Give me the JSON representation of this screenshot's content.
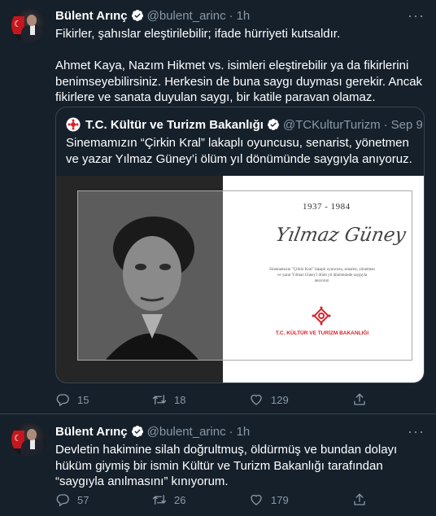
{
  "tweets": [
    {
      "author": {
        "name": "Bülent Arınç",
        "handle": "@bulent_arinc"
      },
      "time": "1h",
      "paragraphs": [
        "Fikirler, şahıslar eleştirilebilir; ifade hürriyeti kutsaldır.",
        "Ahmet Kaya, Nazım Hikmet vs. isimleri eleştirebilir ya da fikirlerini benimseyebilirsiniz. Herkesin de buna saygı duyması gerekir. Ancak fikirlere ve sanata duyulan saygı, bir katile paravan olamaz."
      ],
      "quote": {
        "author": {
          "name": "T.C. Kültür ve Turizm Bakanlığı",
          "handle": "@TCKulturTurizm"
        },
        "time": "Sep 9",
        "text": "Sinemamızın “Çirkin Kral” lakaplı oyuncusu, senarist, yönetmen ve yazar Yılmaz Güney’i ölüm yıl dönümünde saygıyla anıyoruz.",
        "image": {
          "years": "1937 - 1984",
          "signature": "Yılmaz Güney",
          "blurb": "Sinemamızın \"Çirkin Kral\" lakaplı oyuncusu, senarist, yönetmen ve yazar Yılmaz Güney'i ölüm yıl dönümünde saygıyla anıyoruz.",
          "org": "T.C. KÜLTÜR VE TURİZM BAKANLIĞI"
        }
      },
      "stats": {
        "replies": "15",
        "retweets": "18",
        "likes": "129"
      }
    },
    {
      "author": {
        "name": "Bülent Arınç",
        "handle": "@bulent_arinc"
      },
      "time": "1h",
      "paragraphs": [
        "Devletin hakimine silah doğrultmuş, öldürmüş ve bundan dolayı hüküm giymiş bir ismin Kültür ve Turizm Bakanlığı tarafından “saygıyla anılmasını” kınıyorum."
      ],
      "stats": {
        "replies": "57",
        "retweets": "26",
        "likes": "179"
      }
    }
  ],
  "icons": {
    "verified": "verified-badge-icon",
    "reply": "reply-icon",
    "retweet": "retweet-icon",
    "like": "like-icon",
    "share": "share-icon",
    "more": "more-icon"
  },
  "colors": {
    "background": "#15202b",
    "text": "#ffffff",
    "secondary": "#8899a6",
    "border": "#38444d",
    "verified": "#ffffff",
    "ministry_red": "#d6232a"
  }
}
